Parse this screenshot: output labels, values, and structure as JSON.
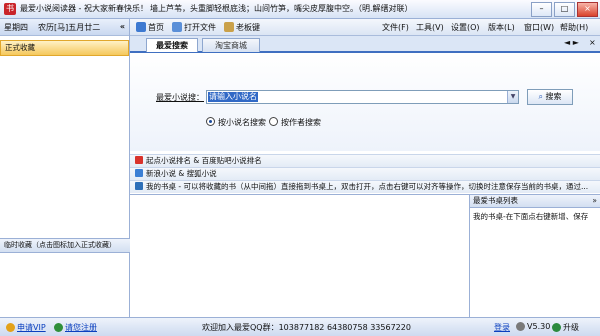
{
  "titlebar": {
    "app_title": "最爱小说阅读器 - 祝大家新春快乐！",
    "marquee": "墙上芦苇，头重脚轻根底浅；山间竹笋，嘴尖皮厚腹中空。（明.解缙对联）",
    "min": "–",
    "max": "□",
    "close": "×"
  },
  "sidebar": {
    "weekday": "星期四",
    "lunar_date": "农历[马]五月廿二",
    "collapse": "«",
    "favorites_header": "正式收藏",
    "temp_bar": "临时收藏（点击图标加入正式收藏）"
  },
  "toolbar": {
    "home": "首页",
    "open_file": "打开文件",
    "boss_key": "老板键",
    "menu": [
      "文件(F)",
      "工具(V)",
      "设置(O)",
      "版本(L)",
      "窗口(W)",
      "帮助(H)"
    ]
  },
  "tabs": {
    "active": "最爱搜索",
    "inactive": "淘宝商城",
    "close": "×",
    "nav": "◄ ►"
  },
  "search": {
    "label": "最爱小说搜：",
    "value": "请输入小说名",
    "button": "搜索",
    "drop": "▼",
    "radio_by_name": "按小说名搜索",
    "radio_by_author": "按作者搜索",
    "selected": "name"
  },
  "links": [
    {
      "text": "起点小说排名 & 百度贴吧小说排名",
      "color": "#d9322b"
    },
    {
      "text": "新浪小说 & 搜狐小说",
      "color": "#3b7fd4"
    },
    {
      "text": "我的书桌       - 可以将收藏的书（从中间拖）直接拖到书桌上，双击打开，点击右键可以对齐等操作，切换时注意保存当前的书桌，通过...",
      "color": "#2d6fb8"
    }
  ],
  "shelf_panel": {
    "header": "最爱书桌列表",
    "close": "»",
    "subtitle": "我的书桌-在下面点右键新增、保存"
  },
  "status": {
    "apply_vip": "申请VIP",
    "login": "请您注册",
    "welcome": "欢迎加入最爱QQ群：103877182  64380758  33567220",
    "register": "登录",
    "version": "V5.30",
    "upgrade": "升级"
  },
  "colors": {
    "accent": "#3f6fc1",
    "favorites": "#f5c85c",
    "selection": "#3169c6"
  }
}
